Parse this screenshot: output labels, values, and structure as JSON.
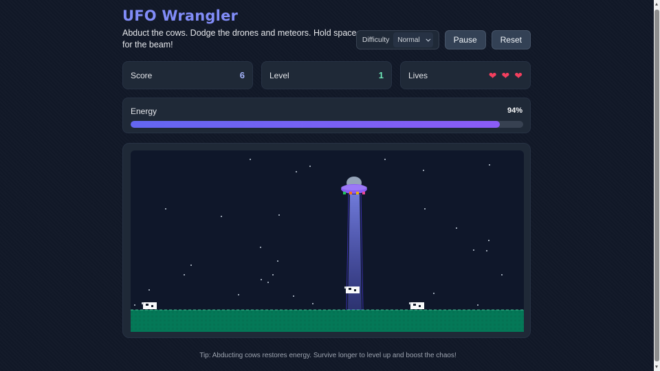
{
  "game": {
    "title": "UFO Wrangler",
    "subtitle": "Abduct the cows. Dodge the drones and meteors. Hold space for the beam!"
  },
  "controls": {
    "difficulty_label": "Difficulty",
    "difficulty_value": "Normal",
    "pause_label": "Pause",
    "reset_label": "Reset"
  },
  "stats": {
    "score_label": "Score",
    "score_value": "6",
    "level_label": "Level",
    "level_value": "1",
    "lives_label": "Lives",
    "lives_count": 3
  },
  "energy": {
    "label": "Energy",
    "value_text": "94%",
    "fraction": 0.94
  },
  "tip": "Tip: Abducting cows restores energy. Survive longer to level up and boost the chaos!",
  "colors": {
    "accent": "#818cf8",
    "score": "#a5b4fc",
    "level": "#6ee7b7",
    "heart": "#f43f5e",
    "ground": "#047857",
    "sky": "#0f172a",
    "beam": "#6366f1"
  },
  "icons": [
    "heart-icon",
    "chevron-down-icon",
    "ufo-icon",
    "cow-icon"
  ]
}
